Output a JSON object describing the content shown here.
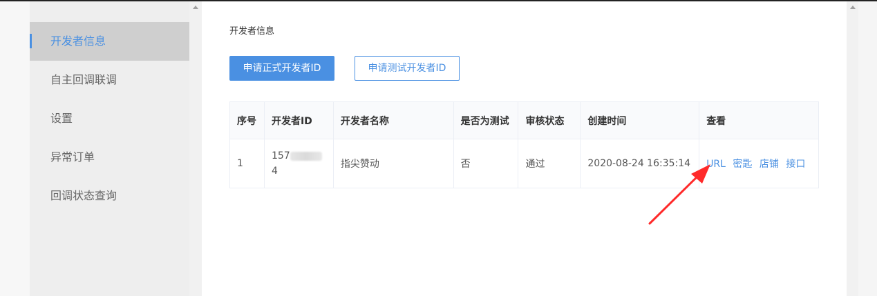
{
  "sidebar": {
    "items": [
      {
        "label": "开发者信息",
        "active": true
      },
      {
        "label": "自主回调联调",
        "active": false
      },
      {
        "label": "设置",
        "active": false
      },
      {
        "label": "异常订单",
        "active": false
      },
      {
        "label": "回调状态查询",
        "active": false
      }
    ]
  },
  "main": {
    "title": "开发者信息",
    "buttons": {
      "apply_formal": "申请正式开发者ID",
      "apply_test": "申请测试开发者ID"
    },
    "table": {
      "headers": [
        "序号",
        "开发者ID",
        "开发者名称",
        "是否为测试",
        "审核状态",
        "创建时间",
        "查看"
      ],
      "rows": [
        {
          "index": "1",
          "dev_id_prefix": "157",
          "dev_id_suffix": "4",
          "dev_name": "指尖赞动",
          "is_test": "否",
          "status": "通过",
          "created": "2020-08-24 16:35:14",
          "links": [
            "URL",
            "密匙",
            "店铺",
            "接口"
          ]
        }
      ]
    }
  },
  "colors": {
    "accent": "#4a90e2",
    "annotation_arrow": "#ff2a2a"
  }
}
